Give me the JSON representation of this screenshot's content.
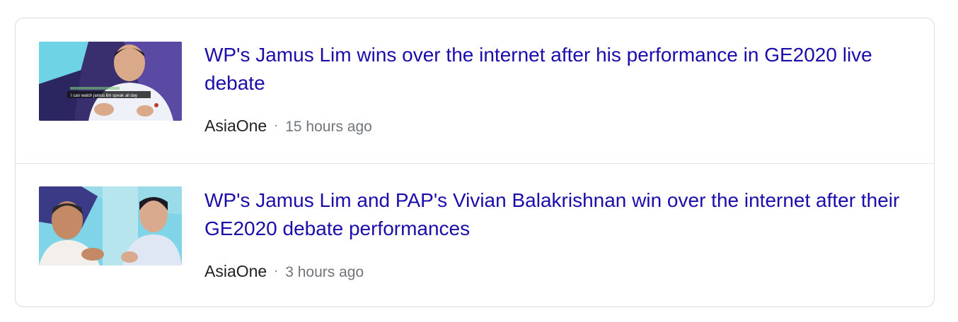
{
  "results": [
    {
      "title": "WP's Jamus Lim wins over the internet after his performance in GE2020 live debate",
      "source": "AsiaOne",
      "separator": "·",
      "time": "15 hours ago",
      "thumbnail_caption": "I can watch jamus lim speak all day"
    },
    {
      "title": "WP's Jamus Lim and PAP's Vivian Balakrishnan win over the internet after their GE2020 debate performances",
      "source": "AsiaOne",
      "separator": "·",
      "time": "3 hours ago"
    }
  ],
  "colors": {
    "link": "#1a0dab",
    "source": "#202124",
    "meta": "#70757a",
    "border": "#dadce0"
  }
}
